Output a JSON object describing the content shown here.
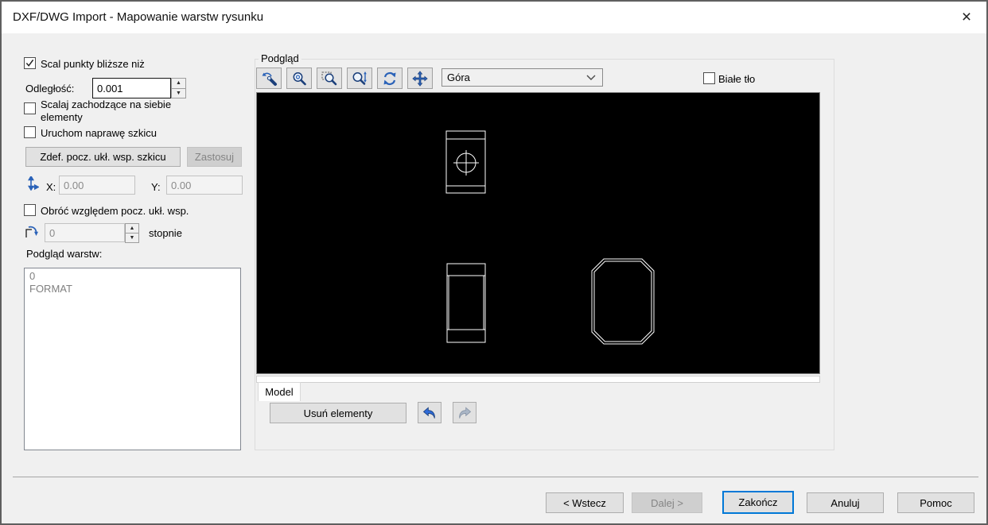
{
  "window": {
    "title": "DXF/DWG Import - Mapowanie warstw rysunku",
    "close_glyph": "×"
  },
  "colors": {
    "dialog_bg": "#f0f0f0",
    "titlebar_bg": "#ffffff",
    "accent_blue": "#0078d7",
    "icon_blue": "#2a62b8",
    "canvas_bg": "#000000",
    "drawing_stroke": "#ffffff"
  },
  "left_panel": {
    "merge_points": {
      "label": "Scal punkty bliższe niż",
      "checked": true
    },
    "distance": {
      "label": "Odległość:",
      "value": "0.001"
    },
    "merge_overlapping": {
      "label_line1": "Scalaj zachodzące na siebie",
      "label_line2": "elementy",
      "checked": false
    },
    "run_repair": {
      "label": "Uruchom naprawę szkicu",
      "checked": false
    },
    "define_origin_button": "Zdef. pocz. ukł. wsp. szkicu",
    "apply_button": "Zastosuj",
    "origin": {
      "x_label": "X:",
      "x_value": "0.00",
      "y_label": "Y:",
      "y_value": "0.00"
    },
    "rotate": {
      "label": "Obróć względem pocz. ukł. wsp.",
      "checked": false,
      "angle_value": "0",
      "unit_label": "stopnie"
    },
    "layers_preview_label": "Podgląd warstw:",
    "layers": [
      "0",
      "FORMAT"
    ]
  },
  "preview": {
    "group_label": "Podgląd",
    "toolbar": {
      "icons": [
        "zoom-selection",
        "zoom",
        "zoom-area",
        "zoom-in-out",
        "refresh",
        "pan"
      ]
    },
    "view_combo": {
      "value": "Góra"
    },
    "white_background": {
      "label": "Białe tło",
      "checked": false
    },
    "model_tab": "Model",
    "delete_button": "Usuń elementy",
    "drawing": {
      "description": "White outline CAD geometry on black: banded rectangle with center-mark circle, banded rectangle, chamfered double-outline octagon"
    }
  },
  "footer": {
    "back": "< Wstecz",
    "next": "Dalej >",
    "finish": "Zakończ",
    "cancel": "Anuluj",
    "help": "Pomoc"
  }
}
